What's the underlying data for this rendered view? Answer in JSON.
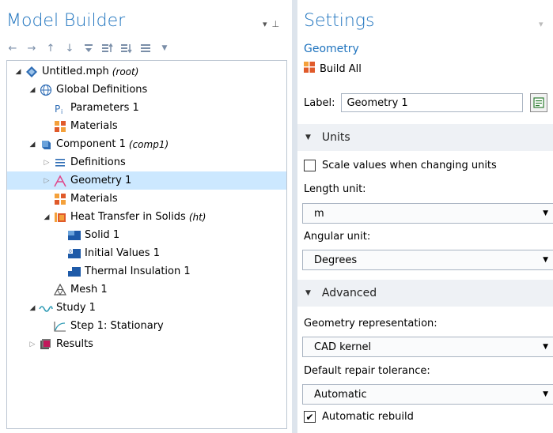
{
  "left": {
    "title": "Model Builder",
    "tree": [
      {
        "label": "Untitled.mph",
        "sub": "(root)",
        "depth": 0,
        "caret": "open",
        "icon": "root-icon"
      },
      {
        "label": "Global Definitions",
        "depth": 1,
        "caret": "open",
        "icon": "globe-icon"
      },
      {
        "label": "Parameters 1",
        "depth": 2,
        "caret": "none",
        "icon": "parameters-icon"
      },
      {
        "label": "Materials",
        "depth": 2,
        "caret": "none",
        "icon": "materials-icon"
      },
      {
        "label": "Component 1",
        "sub": "(comp1)",
        "depth": 1,
        "caret": "open",
        "icon": "component-icon"
      },
      {
        "label": "Definitions",
        "depth": 2,
        "caret": "closed",
        "icon": "definitions-icon"
      },
      {
        "label": "Geometry 1",
        "depth": 2,
        "caret": "closed",
        "icon": "geometry-icon",
        "selected": true
      },
      {
        "label": "Materials",
        "depth": 2,
        "caret": "none",
        "icon": "materials-icon"
      },
      {
        "label": "Heat Transfer in Solids",
        "sub": "(ht)",
        "depth": 2,
        "caret": "open",
        "icon": "heat-transfer-icon"
      },
      {
        "label": "Solid 1",
        "depth": 3,
        "caret": "none",
        "icon": "solid-icon"
      },
      {
        "label": "Initial Values 1",
        "depth": 3,
        "caret": "none",
        "icon": "initial-values-icon"
      },
      {
        "label": "Thermal Insulation 1",
        "depth": 3,
        "caret": "none",
        "icon": "thermal-insulation-icon"
      },
      {
        "label": "Mesh 1",
        "depth": 2,
        "caret": "none",
        "icon": "mesh-icon"
      },
      {
        "label": "Study 1",
        "depth": 1,
        "caret": "open",
        "icon": "study-icon"
      },
      {
        "label": "Step 1: Stationary",
        "depth": 2,
        "caret": "none",
        "icon": "stationary-step-icon"
      },
      {
        "label": "Results",
        "depth": 1,
        "caret": "closed",
        "icon": "results-icon"
      }
    ]
  },
  "right": {
    "title": "Settings",
    "subtitle": "Geometry",
    "build_all": "Build All",
    "label_caption": "Label:",
    "label_value": "Geometry 1",
    "units": {
      "header": "Units",
      "scale_values_label": "Scale values when changing units",
      "scale_values_checked": false,
      "length_unit_label": "Length unit:",
      "length_unit_value": "m",
      "angular_unit_label": "Angular unit:",
      "angular_unit_value": "Degrees"
    },
    "advanced": {
      "header": "Advanced",
      "geometry_rep_label": "Geometry representation:",
      "geometry_rep_value": "CAD kernel",
      "repair_tol_label": "Default repair tolerance:",
      "repair_tol_value": "Automatic",
      "auto_rebuild_label": "Automatic rebuild",
      "auto_rebuild_checked": true
    }
  },
  "colors": {
    "accent": "#1e73be",
    "selected_row": "#cce8ff",
    "section_header": "#eef1f5"
  }
}
